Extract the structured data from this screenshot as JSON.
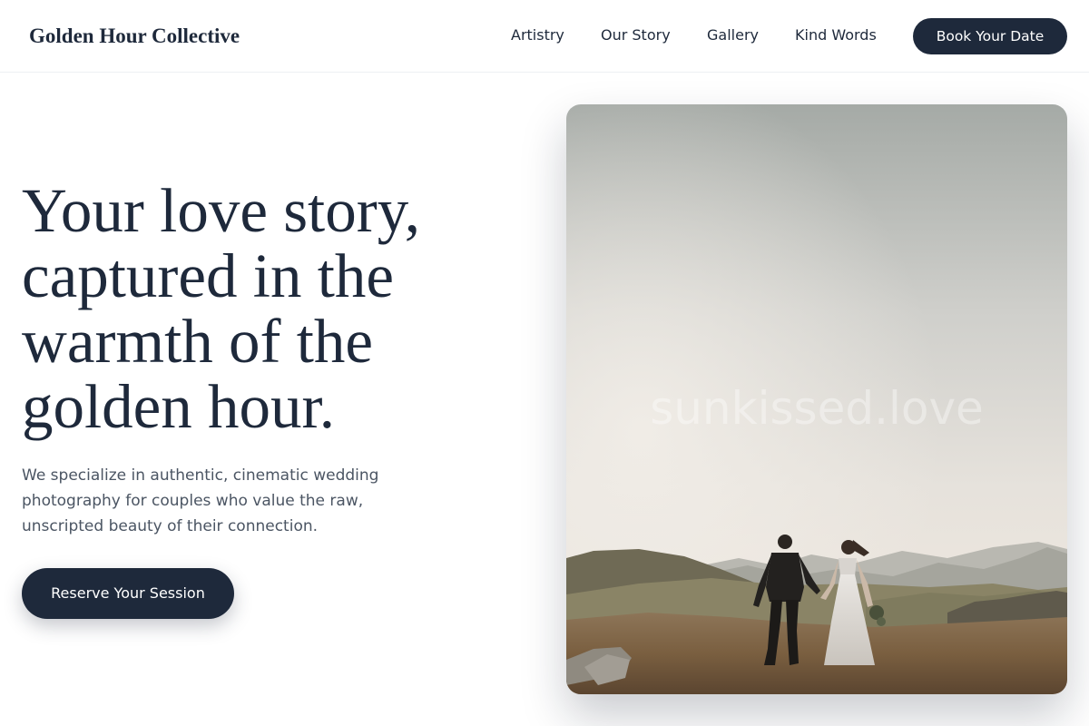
{
  "header": {
    "brand": "Golden Hour Collective",
    "nav": {
      "artistry": "Artistry",
      "story": "Our Story",
      "gallery": "Gallery",
      "kind_words": "Kind Words"
    },
    "cta_label": "Book Your Date"
  },
  "hero": {
    "headline": "Your love story, captured in the warmth of the golden hour.",
    "description": "We specialize in authentic, cinematic wedding photography for couples who value the raw, unscripted beauty of their connection.",
    "cta_label": "Reserve Your Session",
    "photo": {
      "subject": "couple-walking-hillside-at-sunset",
      "watermark": "sunkissed.love"
    }
  },
  "colors": {
    "primary": "#1e293b",
    "body_text": "#4b5563",
    "background": "#ffffff"
  }
}
